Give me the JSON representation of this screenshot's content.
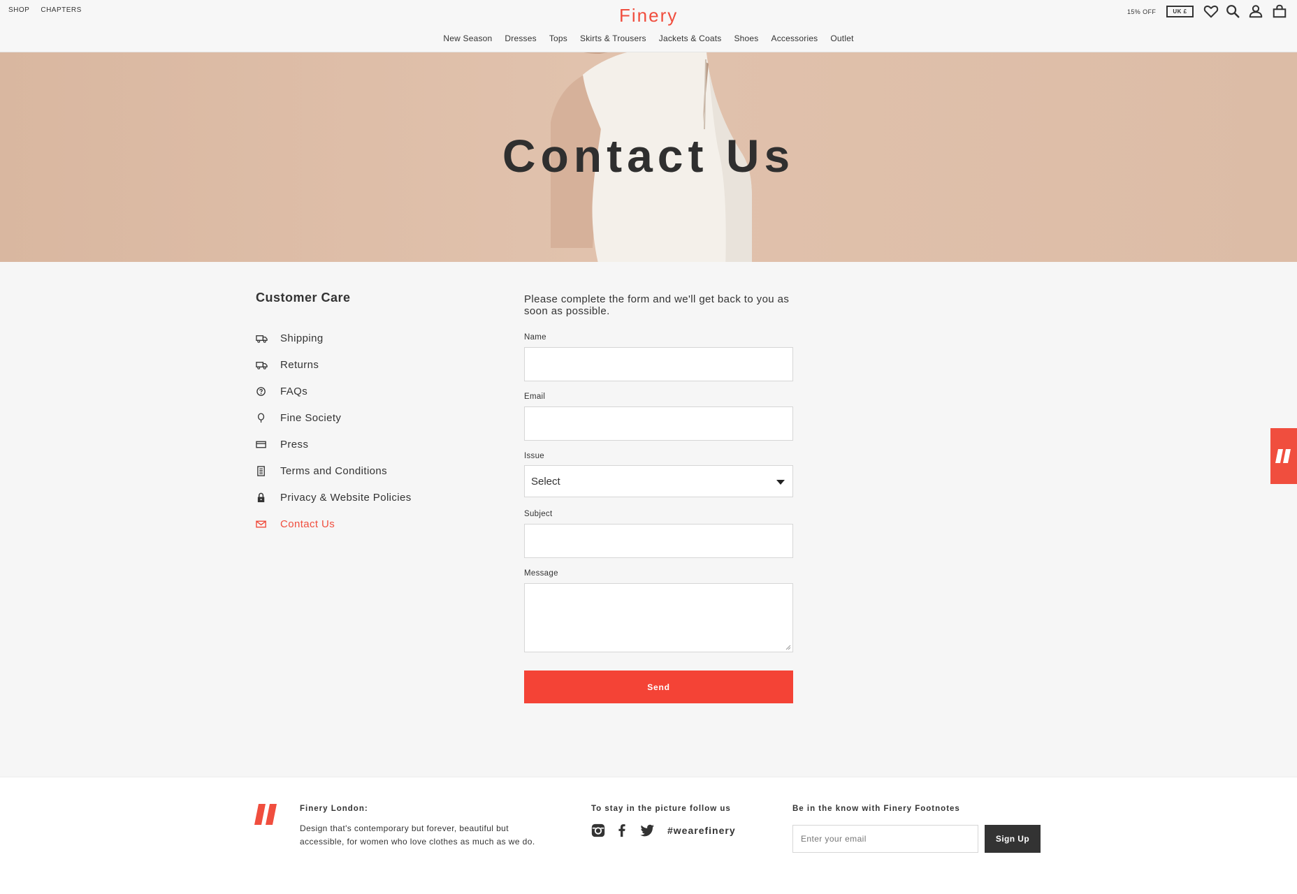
{
  "header": {
    "top_links": [
      "SHOP",
      "CHAPTERS"
    ],
    "logo": "Finery",
    "nav": [
      "New Season",
      "Dresses",
      "Tops",
      "Skirts & Trousers",
      "Jackets & Coats",
      "Shoes",
      "Accessories",
      "Outlet"
    ],
    "promo": "15% OFF",
    "currency": "UK £",
    "icons": [
      "heart-icon",
      "search-icon",
      "account-icon",
      "bag-icon"
    ]
  },
  "hero": {
    "title": "Contact Us"
  },
  "sidebar": {
    "title": "Customer Care",
    "items": [
      {
        "label": "Shipping",
        "icon": "truck-icon"
      },
      {
        "label": "Returns",
        "icon": "truck-icon"
      },
      {
        "label": "FAQs",
        "icon": "question-circle-icon"
      },
      {
        "label": "Fine Society",
        "icon": "balloon-icon"
      },
      {
        "label": "Press",
        "icon": "card-icon"
      },
      {
        "label": "Terms and Conditions",
        "icon": "document-icon"
      },
      {
        "label": "Privacy & Website Policies",
        "icon": "lock-icon"
      },
      {
        "label": "Contact Us",
        "icon": "envelope-icon",
        "active": true
      }
    ]
  },
  "form": {
    "intro": "Please complete the form and we'll get back to you as soon as possible.",
    "name_label": "Name",
    "name_value": "",
    "email_label": "Email",
    "email_value": "",
    "issue_label": "Issue",
    "issue_value": "Select",
    "subject_label": "Subject",
    "subject_value": "",
    "message_label": "Message",
    "message_value": "",
    "send_label": "Send"
  },
  "footer": {
    "about_title": "Finery London:",
    "about_text_1": "Design that's contemporary but forever, beautiful but",
    "about_text_2": "accessible, for women who love clothes as much as we do.",
    "follow_title": "To stay in the picture follow us",
    "hashtag": "#wearefinery",
    "newsletter_title": "Be in the know with Finery Footnotes",
    "email_placeholder": "Enter your email",
    "signup_label": "Sign Up"
  },
  "colors": {
    "accent": "#f04e3e",
    "text": "#333333",
    "background": "#f6f6f6",
    "hero": "#ddbda8"
  }
}
